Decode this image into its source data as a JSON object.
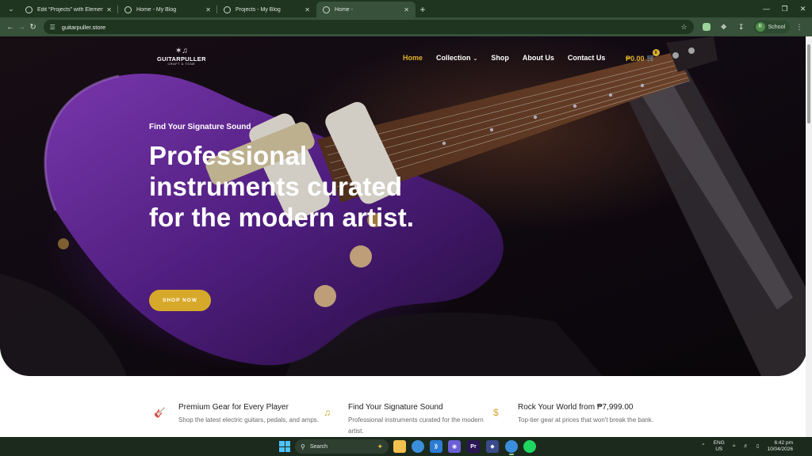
{
  "browser": {
    "tabs": [
      {
        "title": "Edit “Projects” with Elementor",
        "active": false
      },
      {
        "title": "Home - My Blog",
        "active": false
      },
      {
        "title": "Projects - My Blog",
        "active": false
      },
      {
        "title": "Home -",
        "active": true
      }
    ],
    "url": "guitarpuller.store",
    "profile_name": "School",
    "profile_initial": "R"
  },
  "site": {
    "logo_text": "GUITARPULLER",
    "logo_tagline": "CRAFT & TONE",
    "nav": [
      {
        "label": "Home",
        "active": true
      },
      {
        "label": "Collection",
        "active": false,
        "dropdown": true
      },
      {
        "label": "Shop",
        "active": false
      },
      {
        "label": "About Us",
        "active": false
      },
      {
        "label": "Contact Us",
        "active": false
      }
    ],
    "cart_total": "₱0.00",
    "cart_count": "0",
    "accent_color": "#e0b22f"
  },
  "hero": {
    "eyebrow": "Find Your Signature Sound",
    "headline": "Professional instruments curated for the modern artist.",
    "cta": "SHOP NOW"
  },
  "features": [
    {
      "icon": "guitar-icon",
      "title": "Premium Gear for Every Player",
      "text": "Shop the latest electric guitars, pedals, and amps."
    },
    {
      "icon": "music-note-icon",
      "title": "Find Your Signature Sound",
      "text": "Professional instruments curated for the modern artist."
    },
    {
      "icon": "dollar-icon",
      "title": "Rock Your World from ₱7,999.00",
      "text": "Top-tier gear at prices that won't break the bank."
    }
  ],
  "taskbar": {
    "search_placeholder": "Search",
    "language": "ENG",
    "region": "US",
    "time": "6:42 pm",
    "date": "10/04/2026"
  }
}
